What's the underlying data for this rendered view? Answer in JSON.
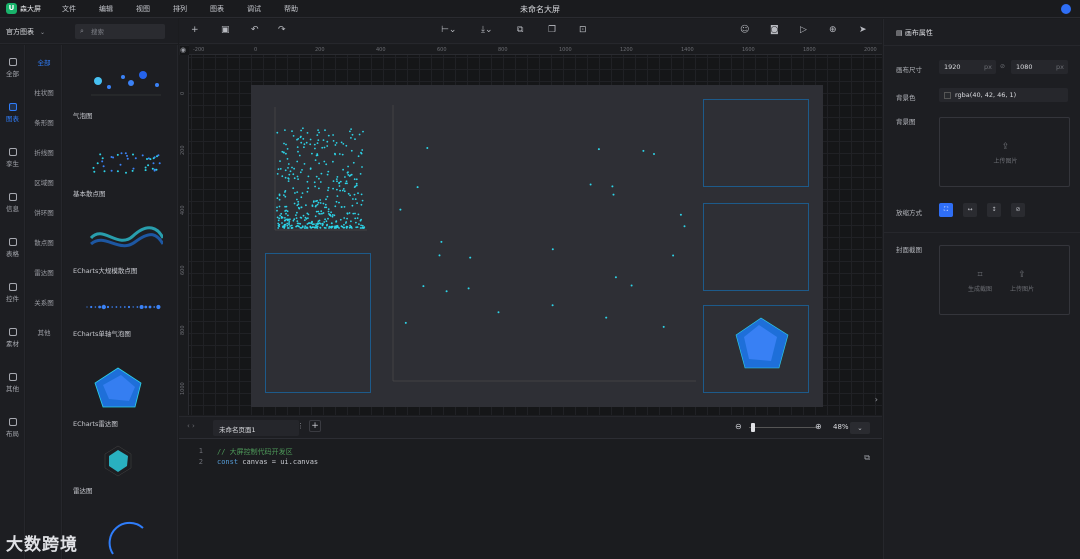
{
  "app": {
    "name": "森大屏",
    "doc_title": "未命名大屏"
  },
  "menu": [
    "文件",
    "编辑",
    "视图",
    "排列",
    "图表",
    "调试",
    "帮助"
  ],
  "left_nav": [
    {
      "label": "全部",
      "icon": "grid-icon"
    },
    {
      "label": "图表",
      "icon": "bar-chart-icon",
      "active": true
    },
    {
      "label": "孪生",
      "icon": "cube-icon"
    },
    {
      "label": "信息",
      "icon": "info-icon"
    },
    {
      "label": "表格",
      "icon": "table-icon"
    },
    {
      "label": "控件",
      "icon": "control-icon"
    },
    {
      "label": "素材",
      "icon": "material-icon"
    },
    {
      "label": "其他",
      "icon": "more-icon"
    },
    {
      "label": "布局",
      "icon": "layout-icon"
    }
  ],
  "panel": {
    "source": "官方图表",
    "search_placeholder": "搜索"
  },
  "categories": [
    "全部",
    "柱状图",
    "条形图",
    "折线图",
    "区域图",
    "饼环图",
    "散点图",
    "雷达图",
    "关系图",
    "其他"
  ],
  "components": [
    {
      "label": "气泡图"
    },
    {
      "label": "基本散点图"
    },
    {
      "label": "ECharts大规模散点图"
    },
    {
      "label": "ECharts单轴气泡图"
    },
    {
      "label": "ECharts雷达图"
    },
    {
      "label": "雷达图"
    }
  ],
  "ruler": {
    "top": [
      "-200",
      "0",
      "200",
      "400",
      "600",
      "800",
      "1000",
      "1200",
      "1400",
      "1600",
      "1800",
      "2000"
    ],
    "left": [
      "0",
      "200",
      "400",
      "600",
      "800",
      "1000"
    ]
  },
  "page_tab": "未命名页面1",
  "zoom": "48%",
  "code": [
    {
      "n": "1",
      "text": "// 大屏控制代码开发区"
    },
    {
      "n": "2",
      "kw": "const",
      "text": " canvas = ui.canvas"
    }
  ],
  "right": {
    "title": "画布属性",
    "size_label": "画布尺寸",
    "width": "1920",
    "height": "1080",
    "unit": "px",
    "bg_color_label": "背景色",
    "bg_color": "rgba(40, 42, 46, 1)",
    "bg_image_label": "背景图",
    "upload_label": "上传图片",
    "fit_label": "放缩方式",
    "cover_label": "封面截图",
    "gen_label": "生成截图"
  },
  "colors": {
    "accent": "#2f7dfa",
    "scatter": "#2dd4e8",
    "radar": "#1e6fd9"
  },
  "watermark": "大数跨境"
}
